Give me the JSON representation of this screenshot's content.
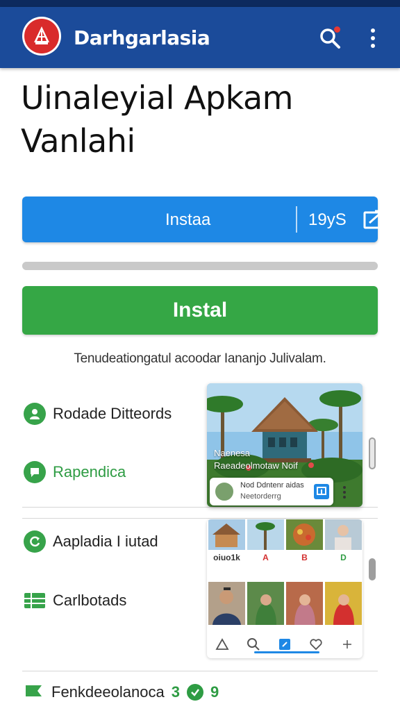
{
  "app_bar": {
    "title": "Darhgarlasia",
    "logo_icon": "pagoda-logo-icon",
    "actions": [
      "search-icon",
      "overflow-menu-icon"
    ],
    "colors": {
      "background": "#1b4b9a",
      "logo": "#d92b2b",
      "notification_dot": "#e53935"
    }
  },
  "page": {
    "title_line1": "Uinaleyial Apkam",
    "title_line2": "Vanlahi"
  },
  "install_bar": {
    "label": "Instaa",
    "size": "19yS",
    "share_icon": "share-icon",
    "color": "#1e88e5"
  },
  "progress": {
    "value": 1.0
  },
  "install_button": {
    "label": "Instal",
    "color": "#35a745"
  },
  "tagline": "Tenudeationgatul acoodar Iananjo Julivalam.",
  "features": [
    {
      "label": "Rodade Ditteords",
      "icon": "user-icon"
    },
    {
      "label": "Rapendica",
      "icon": "chat-bubble-icon"
    },
    {
      "label": "Aapladia I iutad",
      "icon": "refresh-icon"
    },
    {
      "label": "Carlbotads",
      "icon": "grid-icon"
    }
  ],
  "preview": {
    "scene_line1": "Naenesa",
    "scene_line2": "Raeadeolmotaw Noif",
    "card_line1": "Nod Ddntenr aidas",
    "card_line2": "Neetorderrg"
  },
  "gallery": {
    "labels": [
      "oiuo1k",
      "A",
      "B",
      "D"
    ]
  },
  "bottom_feature": {
    "label": "Fenkdeeolanoca",
    "suffix_left": "3",
    "suffix_right": "9"
  }
}
